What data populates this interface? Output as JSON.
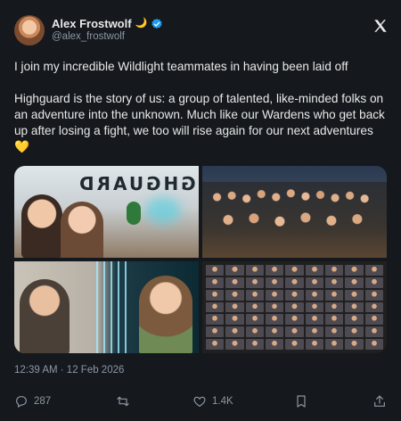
{
  "user": {
    "name": "Alex Frostwolf",
    "name_emoji": "🌙",
    "handle": "@alex_frostwolf"
  },
  "tweet": {
    "line1": "I join my incredible Wildlight teammates in having been laid off",
    "line2": "Highguard is the story of us: a group of talented, like-minded folks on an adventure into the unknown. Much like our Wardens who get back up after losing a fight, we too will rise again for our next adventures 💛"
  },
  "media": {
    "sign_text": "HIGHGUARD"
  },
  "timestamp": "12:39 AM · 12 Feb 2026",
  "actions": {
    "replies": "287",
    "retweets": "",
    "likes": "1.4K"
  },
  "colors": {
    "background": "#15181c",
    "text": "#e7e9ea",
    "muted": "#8b98a5",
    "verified": "#1d9bf0"
  },
  "icons": [
    "verified-badge-icon",
    "x-logo-icon",
    "reply-icon",
    "retweet-icon",
    "like-icon",
    "bookmark-icon",
    "share-icon"
  ]
}
